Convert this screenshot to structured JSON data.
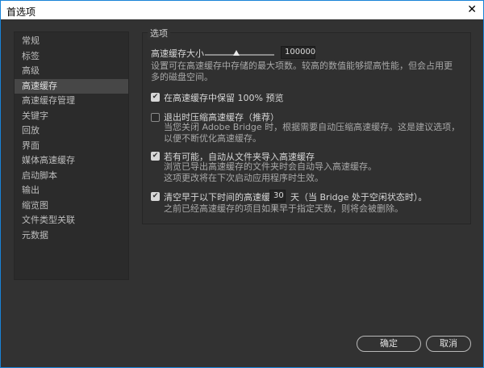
{
  "window": {
    "title": "首选项",
    "close_icon": "close-icon"
  },
  "sidebar": {
    "items": [
      {
        "label": "常规"
      },
      {
        "label": "标签"
      },
      {
        "label": "高级"
      },
      {
        "label": "高速缓存",
        "selected": true
      },
      {
        "label": "高速缓存管理"
      },
      {
        "label": "关键字"
      },
      {
        "label": "回放"
      },
      {
        "label": "界面"
      },
      {
        "label": "媒体高速缓存"
      },
      {
        "label": "启动脚本"
      },
      {
        "label": "输出"
      },
      {
        "label": "缩览图"
      },
      {
        "label": "文件类型关联"
      },
      {
        "label": "元数据"
      }
    ]
  },
  "options": {
    "title": "选项",
    "cache_size": {
      "label": "高速缓存大小",
      "value": "100000",
      "slider_fraction": 0.45,
      "desc": "设置可在高速缓存中存储的最大项数。较高的数值能够提高性能，但会占用更多的磁盘空间。"
    },
    "keep_preview": {
      "label": "在高速缓存中保留 100% 预览",
      "checked": true
    },
    "compact": {
      "label": "退出时压缩高速缓存（推荐）",
      "checked": false,
      "desc": "当您关闭 Adobe Bridge 时，根据需要自动压缩高速缓存。这是建议选项，以便不断优化高速缓存。"
    },
    "auto_import": {
      "label": "若有可能，自动从文件夹导入高速缓存",
      "checked": true,
      "desc1": "浏览已导出高速缓存的文件夹时会自动导入高速缓存。",
      "desc2": "这项更改将在下次启动应用程序时生效。"
    },
    "purge": {
      "label": "清空早于以下时间的高速缓存:",
      "days": "30",
      "suffix": "天（当 Bridge 处于空闲状态时）。",
      "checked": true,
      "desc": "之前已经高速缓存的项目如果早于指定天数，则将会被删除。"
    }
  },
  "buttons": {
    "ok": "确定",
    "cancel": "取消"
  }
}
